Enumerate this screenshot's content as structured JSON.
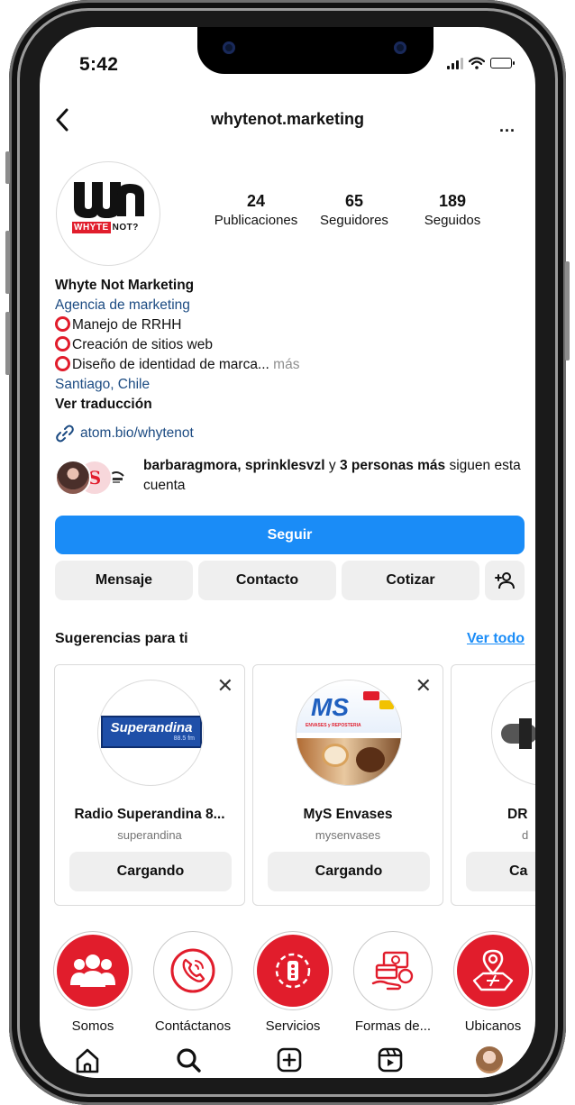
{
  "status": {
    "time": "5:42"
  },
  "header": {
    "username": "whytenot.marketing",
    "more": "..."
  },
  "logo": {
    "tag_red": "WHYTE",
    "tag_black": "NOT?"
  },
  "stats": [
    {
      "num": "24",
      "label": "Publicaciones"
    },
    {
      "num": "65",
      "label": "Seguidores"
    },
    {
      "num": "189",
      "label": "Seguidos"
    }
  ],
  "bio": {
    "name": "Whyte Not Marketing",
    "category": "Agencia de marketing",
    "line1": "Manejo de RRHH",
    "line2": "Creación de sitios web",
    "line3": "Diseño de identidad de marca...",
    "more": "más",
    "location": "Santiago, Chile",
    "translate": "Ver traducción",
    "link": "atom.bio/whytenot"
  },
  "followed_by": {
    "names": "barbaragmora, sprinklesvzl",
    "joiner": " y ",
    "others": "3 personas más",
    "suffix": " siguen esta cuenta"
  },
  "actions": {
    "follow": "Seguir",
    "message": "Mensaje",
    "contact": "Contacto",
    "quote": "Cotizar"
  },
  "suggestions": {
    "title": "Sugerencias para ti",
    "see_all": "Ver todo",
    "cards": [
      {
        "name": "Radio Superandina 8...",
        "handle": "superandina",
        "button": "Cargando",
        "avatar_text": "Superandina",
        "avatar_sub": "88.5 fm"
      },
      {
        "name": "MyS Envases",
        "handle": "mysenvases",
        "button": "Cargando",
        "avatar_text": "MS",
        "avatar_sub": "ENVASES y REPOSTERIA"
      },
      {
        "name": "DR",
        "handle": "d",
        "button": "Ca"
      }
    ]
  },
  "highlights": [
    {
      "label": "Somos"
    },
    {
      "label": "Contáctanos"
    },
    {
      "label": "Servicios"
    },
    {
      "label": "Formas de..."
    },
    {
      "label": "Ubicanos"
    }
  ],
  "colors": {
    "accent": "#1a8cf7",
    "brand_red": "#e11d2c",
    "link_blue": "#1c4b82"
  }
}
